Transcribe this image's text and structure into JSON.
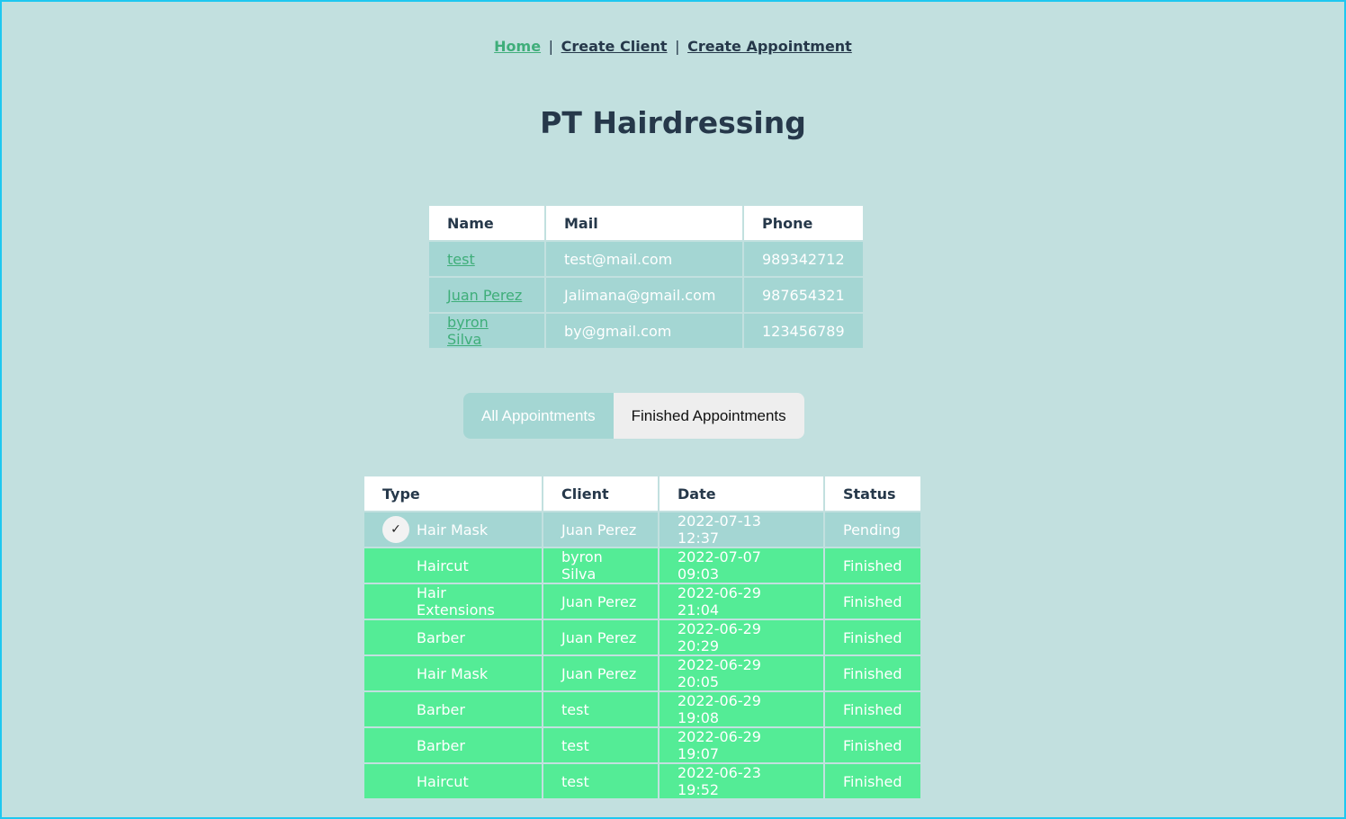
{
  "nav": {
    "home": "Home",
    "create_client": "Create Client",
    "create_appointment": "Create Appointment",
    "separator": "|"
  },
  "page_title": "PT Hairdressing",
  "clients": {
    "headers": [
      "Name",
      "Mail",
      "Phone"
    ],
    "rows": [
      {
        "name": "test",
        "mail": "test@mail.com",
        "phone": "989342712"
      },
      {
        "name": "Juan Perez",
        "mail": "Jalimana@gmail.com",
        "phone": "987654321"
      },
      {
        "name": "byron Silva",
        "mail": "by@gmail.com",
        "phone": "123456789"
      }
    ]
  },
  "tabs": {
    "all": "All Appointments",
    "finished": "Finished Appointments"
  },
  "appointments": {
    "headers": [
      "Type",
      "Client",
      "Date",
      "Status"
    ],
    "check_icon": "✓",
    "rows": [
      {
        "type": "Hair Mask",
        "client": "Juan Perez",
        "date": "2022-07-13 12:37",
        "status": "Pending"
      },
      {
        "type": "Haircut",
        "client": "byron Silva",
        "date": "2022-07-07 09:03",
        "status": "Finished"
      },
      {
        "type": "Hair Extensions",
        "client": "Juan Perez",
        "date": "2022-06-29 21:04",
        "status": "Finished"
      },
      {
        "type": "Barber",
        "client": "Juan Perez",
        "date": "2022-06-29 20:29",
        "status": "Finished"
      },
      {
        "type": "Hair Mask",
        "client": "Juan Perez",
        "date": "2022-06-29 20:05",
        "status": "Finished"
      },
      {
        "type": "Barber",
        "client": "test",
        "date": "2022-06-29 19:08",
        "status": "Finished"
      },
      {
        "type": "Barber",
        "client": "test",
        "date": "2022-06-29 19:07",
        "status": "Finished"
      },
      {
        "type": "Haircut",
        "client": "test",
        "date": "2022-06-23 19:52",
        "status": "Finished"
      }
    ]
  },
  "colors": {
    "background": "#c2e0df",
    "pending_row": "#a4d6d3",
    "finished_row": "#54ec96",
    "link_active": "#3fae7a",
    "text_dark": "#26384a"
  }
}
